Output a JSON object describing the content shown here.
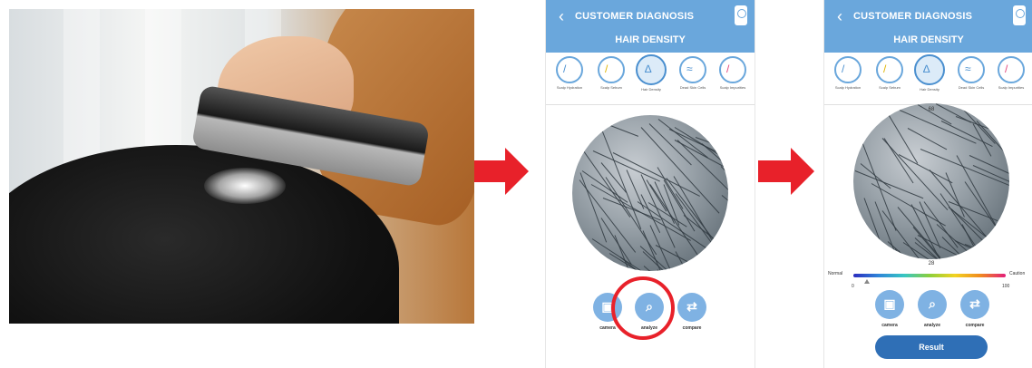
{
  "phone1": {
    "title": "CUSTOMER DIAGNOSIS",
    "subtitle": "HAIR DENSITY",
    "categories": [
      {
        "label": "Scalp Hydration",
        "icon": "scalp-hydration-icon"
      },
      {
        "label": "Scalp Sebum",
        "icon": "scalp-sebum-icon"
      },
      {
        "label": "Hair Density",
        "icon": "hair-density-icon"
      },
      {
        "label": "Dead Skin Cells",
        "icon": "dead-skin-cells-icon"
      },
      {
        "label": "Scalp Impurities",
        "icon": "scalp-impurities-icon"
      }
    ],
    "buttons": [
      {
        "label": "camera",
        "icon": "camera-icon"
      },
      {
        "label": "analyze",
        "icon": "analyze-icon"
      },
      {
        "label": "compare",
        "icon": "compare-icon"
      }
    ]
  },
  "phone2": {
    "title": "CUSTOMER DIAGNOSIS",
    "subtitle": "HAIR DENSITY",
    "categories": [
      {
        "label": "Scalp Hydration",
        "icon": "scalp-hydration-icon"
      },
      {
        "label": "Scalp Sebum",
        "icon": "scalp-sebum-icon"
      },
      {
        "label": "Hair Density",
        "icon": "hair-density-icon"
      },
      {
        "label": "Dead Skin Cells",
        "icon": "dead-skin-cells-icon"
      },
      {
        "label": "Scalp Impurities",
        "icon": "scalp-impurities-icon"
      }
    ],
    "top_value": "68",
    "bottom_value": "28",
    "scale": {
      "left": "Normal",
      "right": "Caution",
      "min": "0",
      "max": "100"
    },
    "buttons": [
      {
        "label": "camera",
        "icon": "camera-icon"
      },
      {
        "label": "analyze",
        "icon": "analyze-icon"
      },
      {
        "label": "compare",
        "icon": "compare-icon"
      }
    ],
    "result_label": "Result"
  },
  "colors": {
    "header": "#6aa7dc",
    "arrow": "#e8212a",
    "result": "#2f6fb6"
  }
}
